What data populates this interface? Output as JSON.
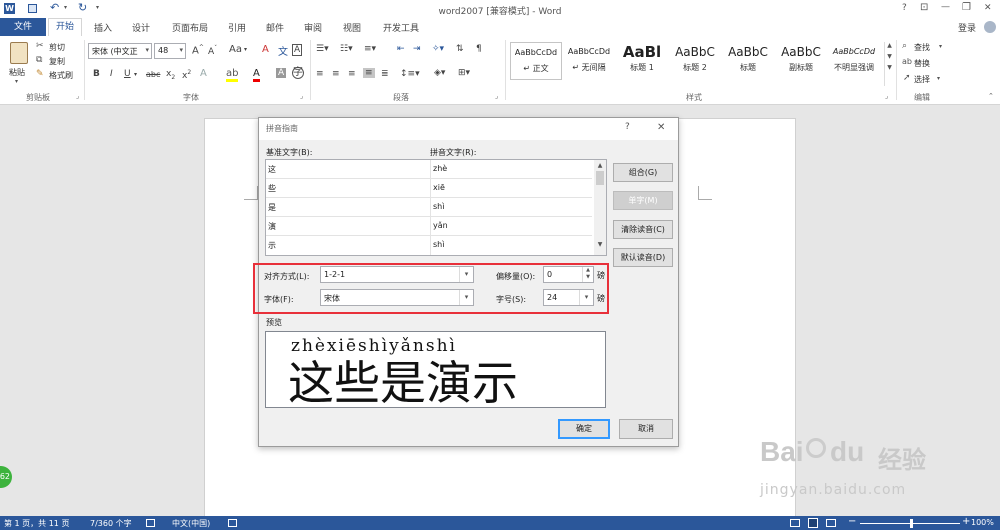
{
  "window": {
    "title": "word2007 [兼容模式] - Word",
    "controls": [
      "?",
      "⊡",
      "—",
      "❐",
      "✕"
    ]
  },
  "quick_access": {
    "save_icon": "save-icon",
    "undo_icon": "undo-icon",
    "redo_icon": "redo-icon"
  },
  "tabs": [
    {
      "label": "文件"
    },
    {
      "label": "开始"
    },
    {
      "label": "插入"
    },
    {
      "label": "设计"
    },
    {
      "label": "页面布局"
    },
    {
      "label": "引用"
    },
    {
      "label": "邮件"
    },
    {
      "label": "审阅"
    },
    {
      "label": "视图"
    },
    {
      "label": "开发工具"
    }
  ],
  "login_label": "登录",
  "ribbon": {
    "clipboard": {
      "paste": "粘贴",
      "cut": "剪切",
      "copy": "复制",
      "format_painter": "格式刷",
      "group": "剪贴板"
    },
    "font": {
      "name": "宋体 (中文正",
      "size": "48",
      "change_case": "Aa",
      "group": "字体",
      "wen": "文",
      "char_border": "A"
    },
    "paragraph": {
      "group": "段落"
    },
    "styles": {
      "items": [
        {
          "sample": "AaBbCcDd",
          "name": "↵ 正文"
        },
        {
          "sample": "AaBbCcDd",
          "name": "↵ 无间隔"
        },
        {
          "sample": "AaBl",
          "name": "标题 1"
        },
        {
          "sample": "AaBbC",
          "name": "标题 2"
        },
        {
          "sample": "AaBbC",
          "name": "标题"
        },
        {
          "sample": "AaBbC",
          "name": "副标题"
        },
        {
          "sample": "AaBbCcDd",
          "name": "不明显强调"
        }
      ],
      "group": "样式"
    },
    "editing": {
      "find": "查找",
      "replace": "替换",
      "select": "选择",
      "group": "编辑"
    }
  },
  "dialog": {
    "title": "拼音指南",
    "help": "?",
    "close": "✕",
    "base_text_label": "基准文字(B):",
    "ruby_text_label": "拼音文字(R):",
    "rows": [
      {
        "base": "这",
        "ruby": "zhè"
      },
      {
        "base": "些",
        "ruby": "xiē"
      },
      {
        "base": "是",
        "ruby": "shì"
      },
      {
        "base": "演",
        "ruby": "yǎn"
      },
      {
        "base": "示",
        "ruby": "shì"
      }
    ],
    "buttons": {
      "group": "组合(G)",
      "single": "单字(M)",
      "clear": "清除读音(C)",
      "default": "默认读音(D)"
    },
    "alignment_label": "对齐方式(L):",
    "alignment_value": "1-2-1",
    "offset_label": "偏移量(O):",
    "offset_value": "0",
    "offset_unit": "磅",
    "font_label": "字体(F):",
    "font_value": "宋体",
    "size_label": "字号(S):",
    "size_value": "24",
    "size_unit": "磅",
    "preview_label": "预览",
    "preview_ruby": "zhèxiēshìyǎnshì",
    "preview_text": "这些是演示",
    "ok": "确定",
    "cancel": "取消"
  },
  "status": {
    "page": "第 1 页，共 11 页",
    "words": "7/360 个字",
    "lang": "中文(中国)",
    "zoom": "100%",
    "zoom_level": 1.0
  },
  "watermark": {
    "brand": "Bai",
    "brand2": "经验",
    "url": "jingyan.baidu.com"
  },
  "badge": "62",
  "colors": {
    "brand_blue": "#2b579a",
    "highlight_red": "#e8303a"
  }
}
